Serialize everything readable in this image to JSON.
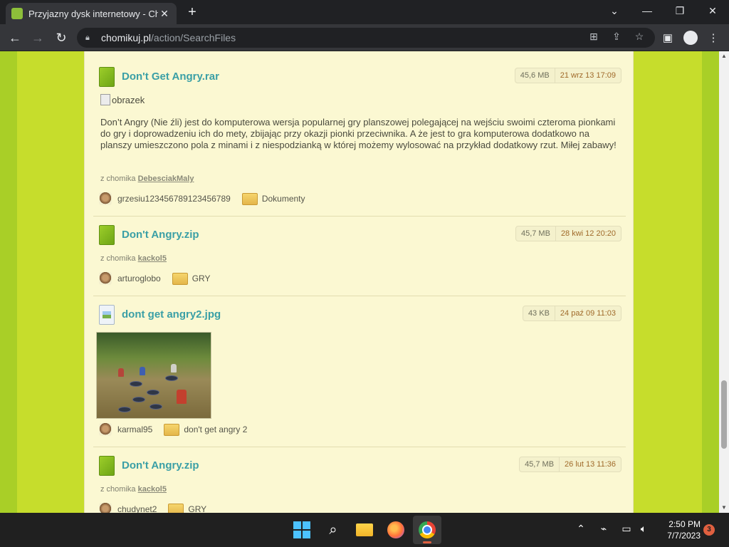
{
  "browser": {
    "tab_title": "Przyjazny dysk internetowy - Chomikuj.pl",
    "tab_close": "✕",
    "new_tab": "+",
    "url_host": "chomikuj.pl",
    "url_path": "/action/SearchFiles",
    "window": {
      "minimize": "—",
      "restore": "❐",
      "close": "✕",
      "dropdown": "⌄"
    }
  },
  "results": [
    {
      "name": "Don't Get Angry.rar",
      "type": "archive",
      "size": "45,6 MB",
      "date": "21 wrz 13 17:09",
      "broken_image_alt": "obrazek",
      "description": "Don’t Angry (Nie źli) jest do komputerowa wersja popularnej gry planszowej polegającej na wejściu swoimi czteroma pionkami do gry i doprowadzeniu ich do mety, zbijając przy okazji pionki przeciwnika. A że jest to gra komputerowa dodatkowo na planszy umieszczono pola z minami i z niespodzianką w której możemy wylosować na przykład dodatkowy rzut. Miłej zabawy!",
      "from_label": "z chomika",
      "from_user": "DebesciakMaly",
      "owner": "grzesiu123456789123456789",
      "folder": "Dokumenty"
    },
    {
      "name": "Don't Angry.zip",
      "type": "archive",
      "size": "45,7 MB",
      "date": "28 kwi 12 20:20",
      "from_label": "z chomika",
      "from_user": "kackol5",
      "owner": "arturoglobo",
      "folder": "GRY"
    },
    {
      "name": "dont get angry2.jpg",
      "type": "image",
      "size": "43 KB",
      "date": "24 paź 09 11:03",
      "owner": "karmal95",
      "folder": "don't get angry 2"
    },
    {
      "name": "Don't Angry.zip",
      "type": "archive",
      "size": "45,7 MB",
      "date": "26 lut 13 11:36",
      "from_label": "z chomika",
      "from_user": "kackol5",
      "owner": "chudynet2",
      "folder": "GRY"
    }
  ],
  "taskbar": {
    "time": "2:50 PM",
    "date": "7/7/2023",
    "notifications": "3"
  }
}
